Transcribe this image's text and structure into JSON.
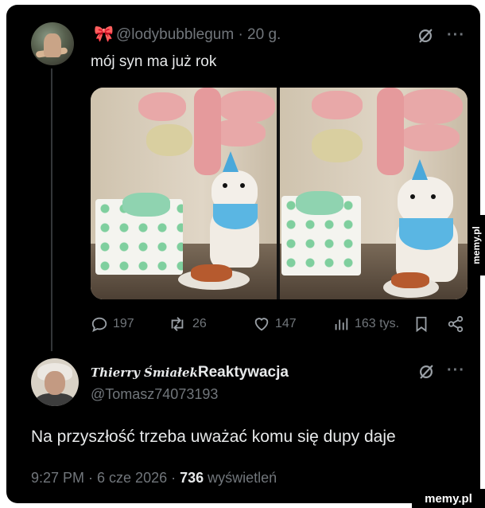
{
  "tweet1": {
    "handle_line": "@lodybubblegum · 20 g.",
    "text": "mój syn ma już rok"
  },
  "actions": {
    "replies": "197",
    "retweets": "26",
    "likes": "147",
    "views": "163 tys."
  },
  "tweet2": {
    "name_script": "Thierry Śmiałek",
    "name_plain": "Reaktywacja",
    "handle": "@Tomasz74073193",
    "text": "Na przyszłość trzeba uważać komu się dupy daje",
    "time": "9:27 PM · 6 cze 2026 · ",
    "views_count": "736",
    "views_label": " wyświetleń"
  },
  "watermark": "memy.pl",
  "colors": {
    "background": "#000000",
    "text": "#e7e9ea",
    "secondary": "#71767b"
  }
}
